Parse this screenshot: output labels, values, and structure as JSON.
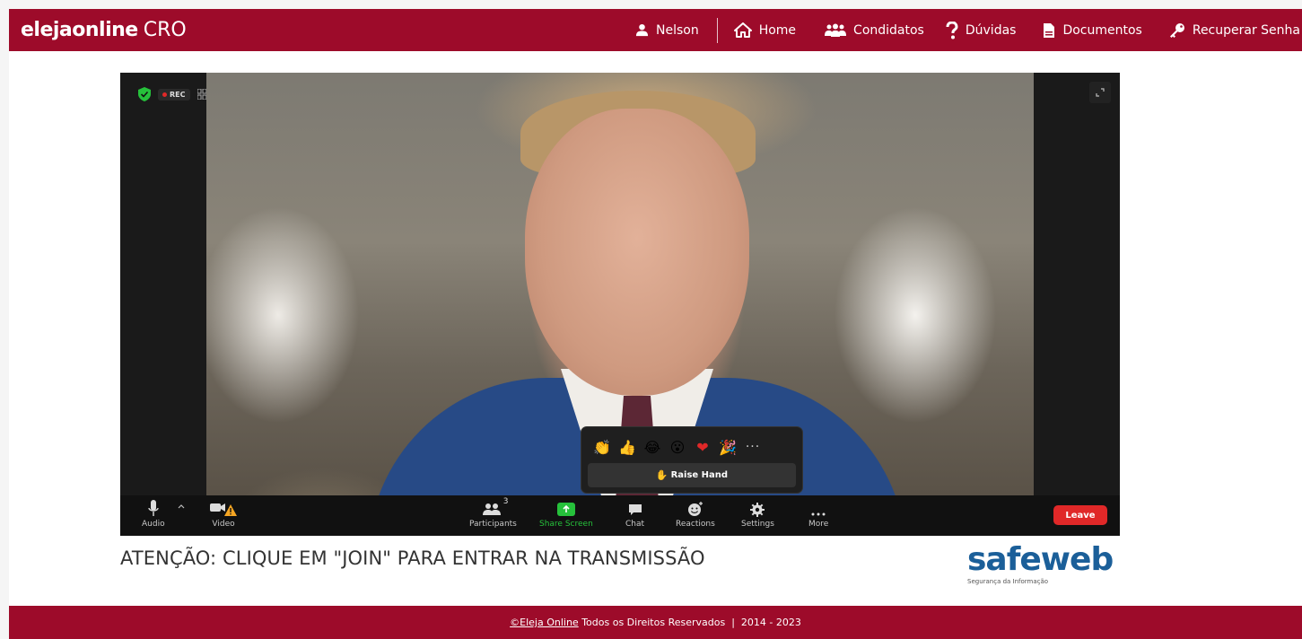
{
  "header": {
    "brand": "elejaonline",
    "brand_sub": "CRO",
    "user_name": "Nelson",
    "nav": {
      "home": "Home",
      "candidates": "Condidatos",
      "faq": "Dúvidas",
      "documents": "Documentos",
      "recover_password": "Recuperar Senha"
    }
  },
  "video": {
    "rec_label": "REC",
    "reactions": {
      "emojis": [
        "👏",
        "👍",
        "😂",
        "😮",
        "❤",
        "🎉"
      ],
      "more": "···",
      "raise_hand_icon": "✋",
      "raise_hand_label": "Raise Hand"
    },
    "controls": {
      "audio": "Audio",
      "video": "Video",
      "participants": "Participants",
      "participants_count": "3",
      "share_screen": "Share Screen",
      "chat": "Chat",
      "reactions": "Reactions",
      "settings": "Settings",
      "more": "More",
      "leave": "Leave"
    },
    "colors": {
      "share_green": "#26c13b",
      "leave_red": "#e02828"
    }
  },
  "attention_text": "ATENÇÃO: CLIQUE EM \"JOIN\" PARA ENTRAR NA TRANSMISSÃO",
  "sponsor": {
    "name": "safeweb",
    "tagline": "Segurança da Informação"
  },
  "footer": {
    "link": "©Eleja Online",
    "text": " Todos os Direitos Reservados  |  2014 - 2023"
  },
  "theme": {
    "brand_color": "#9d0b2a"
  }
}
